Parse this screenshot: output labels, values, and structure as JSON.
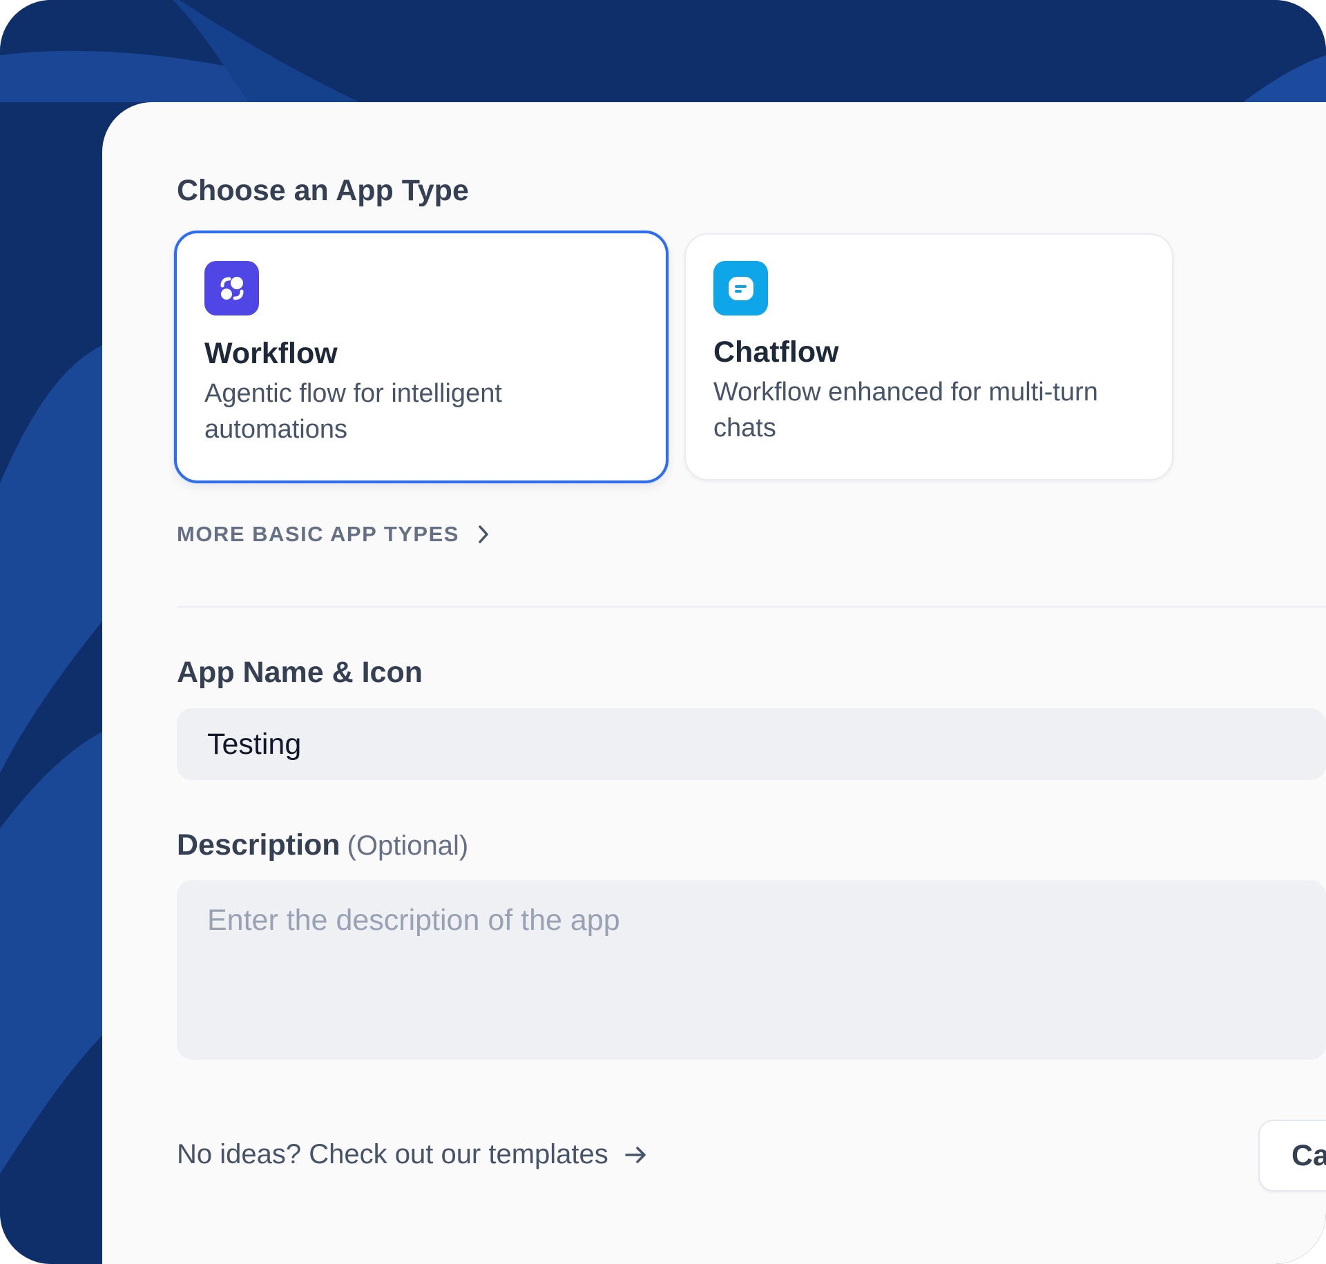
{
  "app_type": {
    "title": "Choose an App Type",
    "cards": [
      {
        "title": "Workflow",
        "description": "Agentic flow for intelligent automations",
        "icon": "workflow-icon",
        "icon_color": "#4f46e5",
        "selected": true
      },
      {
        "title": "Chatflow",
        "description": "Workflow enhanced for multi-turn chats",
        "icon": "chat-bubble-icon",
        "icon_color": "#0ea5e9",
        "selected": false
      }
    ],
    "more_types_label": "MORE BASIC APP TYPES"
  },
  "app_name": {
    "label": "App Name & Icon",
    "value": "Testing"
  },
  "description": {
    "label": "Description",
    "optional_label": "(Optional)",
    "placeholder": "Enter the description of the app"
  },
  "footer": {
    "templates_link": "No ideas? Check out our templates",
    "cancel_label": "Ca"
  },
  "colors": {
    "accent": "#2f6df0",
    "background": "#0f2f6b"
  }
}
